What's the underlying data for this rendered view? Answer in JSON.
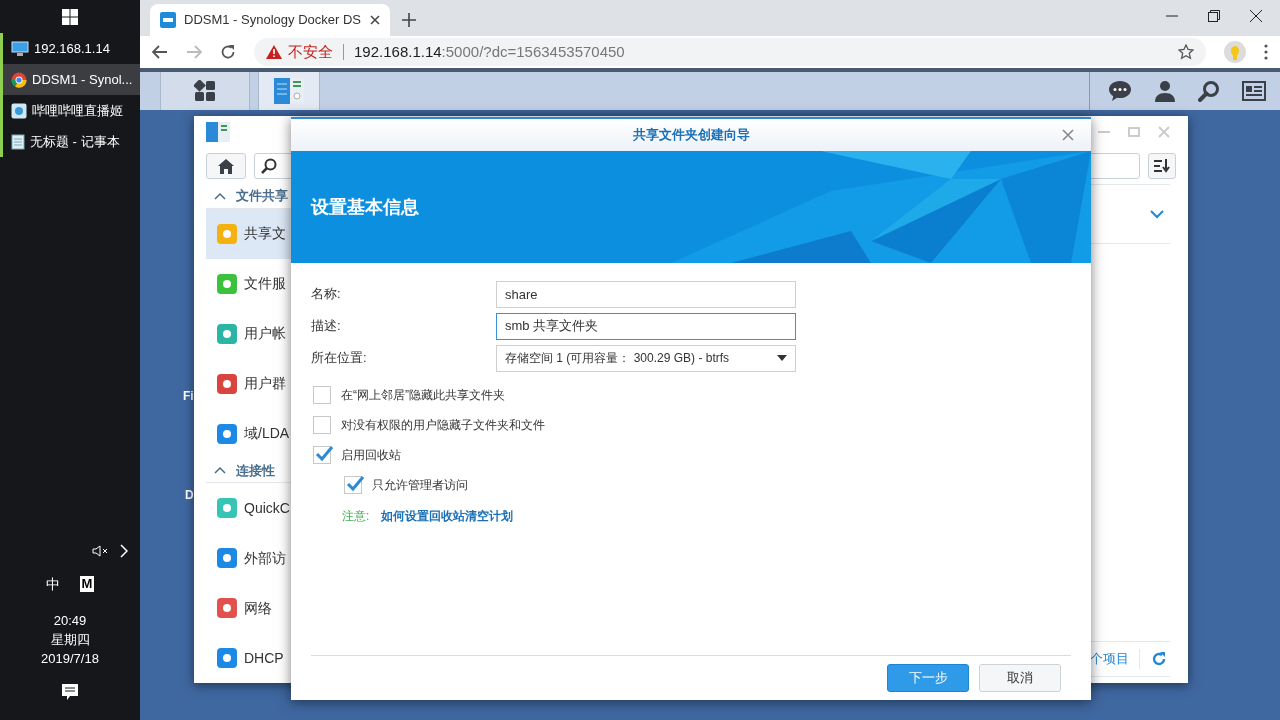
{
  "taskbar": {
    "items": [
      {
        "label": "192.168.1.14",
        "selected": false
      },
      {
        "label": "DDSM1 - Synol...",
        "selected": true
      },
      {
        "label": "哔哩哔哩直播姬",
        "selected": false
      },
      {
        "label": "无标题 - 记事本",
        "selected": false
      }
    ],
    "ime": "中",
    "ime_mode": "M",
    "time": "20:49",
    "weekday": "星期四",
    "date": "2019/7/18"
  },
  "browser": {
    "tab_title": "DDSM1 - Synology Docker DS",
    "security_label": "不安全",
    "url_host": "192.168.1.14",
    "url_rest": ":5000/?dc=1563453570450"
  },
  "desktop": {
    "icon_labels": [
      "Fi",
      "D"
    ]
  },
  "control_panel": {
    "sidebar": [
      {
        "kind": "section",
        "label": "文件共享",
        "expanded": true
      },
      {
        "kind": "item",
        "label": "共享文",
        "selected": true
      },
      {
        "kind": "item",
        "label": "文件服",
        "selected": false
      },
      {
        "kind": "item",
        "label": "用户帐",
        "selected": false
      },
      {
        "kind": "item",
        "label": "用户群",
        "selected": false
      },
      {
        "kind": "item",
        "label": "域/LDA",
        "selected": false
      },
      {
        "kind": "section",
        "label": "连接性",
        "expanded": true
      },
      {
        "kind": "item",
        "label": "QuickC",
        "selected": false
      },
      {
        "kind": "item",
        "label": "外部访",
        "selected": false
      },
      {
        "kind": "item",
        "label": "网络",
        "selected": false
      },
      {
        "kind": "item",
        "label": "DHCP",
        "selected": false
      }
    ],
    "footer_text": "个项目"
  },
  "dialog": {
    "title": "共享文件夹创建向导",
    "heading": "设置基本信息",
    "fields": [
      {
        "label": "名称:",
        "kind": "text",
        "value": "share",
        "focused": false
      },
      {
        "label": "描述:",
        "kind": "text",
        "value": "smb 共享文件夹",
        "focused": true
      },
      {
        "label": "所在位置:",
        "kind": "select",
        "value": "存储空间 1 (可用容量： 300.29 GB) - btrfs",
        "focused": false
      }
    ],
    "options": [
      {
        "label": "在“网上邻居”隐藏此共享文件夹",
        "checked": false
      },
      {
        "label": "对没有权限的用户隐藏子文件夹和文件",
        "checked": false
      },
      {
        "label": "启用回收站",
        "checked": true,
        "children": [
          {
            "label": "只允许管理者访问",
            "checked": true
          }
        ]
      }
    ],
    "note": {
      "label": "注意:",
      "link": "如何设置回收站清空计划"
    },
    "buttons": [
      {
        "label": "下一步",
        "kind": "primary"
      },
      {
        "label": "取消",
        "kind": "secondary"
      }
    ]
  }
}
